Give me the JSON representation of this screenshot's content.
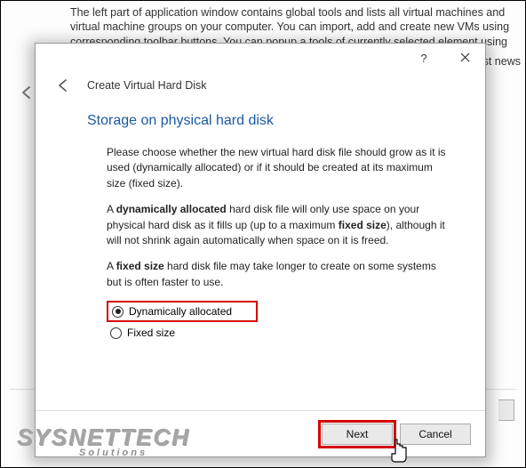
{
  "background": {
    "intro_text": "The left part of application window contains global tools and lists all virtual machines and virtual machine groups on your computer. You can import, add and create new VMs using corresponding toolbar buttons. You can popup a tools of currently selected element using corresponding element button.",
    "right_text": "ation and latest news"
  },
  "dialog": {
    "back_label": "Create Virtual Hard Disk",
    "heading": "Storage on physical hard disk",
    "para1": "Please choose whether the new virtual hard disk file should grow as it is used (dynamically allocated) or if it should be created at its maximum size (fixed size).",
    "para2a": "A ",
    "para2b": "dynamically allocated",
    "para2c": " hard disk file will only use space on your physical hard disk as it fills up (up to a maximum ",
    "para2d": "fixed size",
    "para2e": "), although it will not shrink again automatically when space on it is freed.",
    "para3a": "A ",
    "para3b": "fixed size",
    "para3c": " hard disk file may take longer to create on some systems but is often faster to use.",
    "radio1": "Dynamically allocated",
    "radio2": "Fixed size",
    "next": "Next",
    "cancel": "Cancel"
  },
  "watermark": {
    "main": "SYSNETTECH",
    "sub": "Solutions"
  }
}
